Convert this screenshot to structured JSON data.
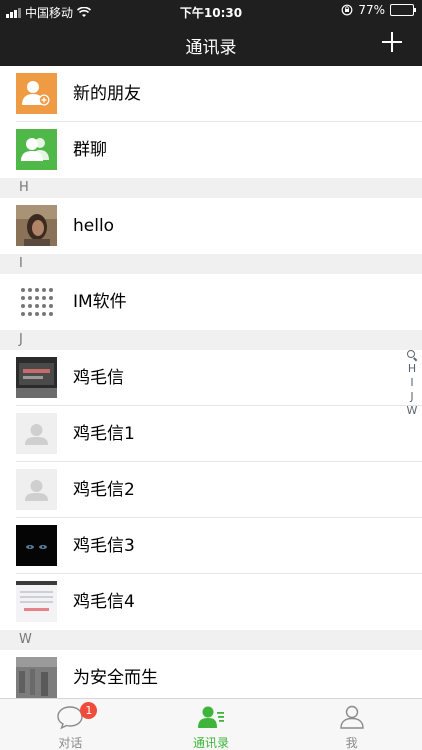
{
  "status_bar": {
    "carrier": "中国移动",
    "time": "下午10:30",
    "battery": "77%",
    "battery_level": 0.77
  },
  "nav": {
    "title": "通讯录"
  },
  "fixed_items": [
    {
      "label": "新的朋友",
      "icon": "add-friend-icon",
      "color": "#ef9b43"
    },
    {
      "label": "群聊",
      "icon": "group-chat-icon",
      "color": "#4fb848"
    }
  ],
  "sections": [
    {
      "letter": "H",
      "contacts": [
        {
          "name": "hello"
        }
      ]
    },
    {
      "letter": "I",
      "contacts": [
        {
          "name": "IM软件"
        }
      ]
    },
    {
      "letter": "J",
      "contacts": [
        {
          "name": "鸡毛信"
        },
        {
          "name": "鸡毛信1"
        },
        {
          "name": "鸡毛信2"
        },
        {
          "name": "鸡毛信3"
        },
        {
          "name": "鸡毛信4"
        }
      ]
    },
    {
      "letter": "W",
      "contacts": [
        {
          "name": "为安全而生"
        }
      ]
    }
  ],
  "index_bar": [
    "H",
    "I",
    "J",
    "W"
  ],
  "tabbar": {
    "tabs": [
      {
        "label": "对话",
        "badge": "1",
        "icon": "chat-bubble-icon"
      },
      {
        "label": "通讯录",
        "icon": "contacts-icon",
        "active": true
      },
      {
        "label": "我",
        "icon": "profile-icon"
      }
    ],
    "active_color": "#3fb43a"
  }
}
